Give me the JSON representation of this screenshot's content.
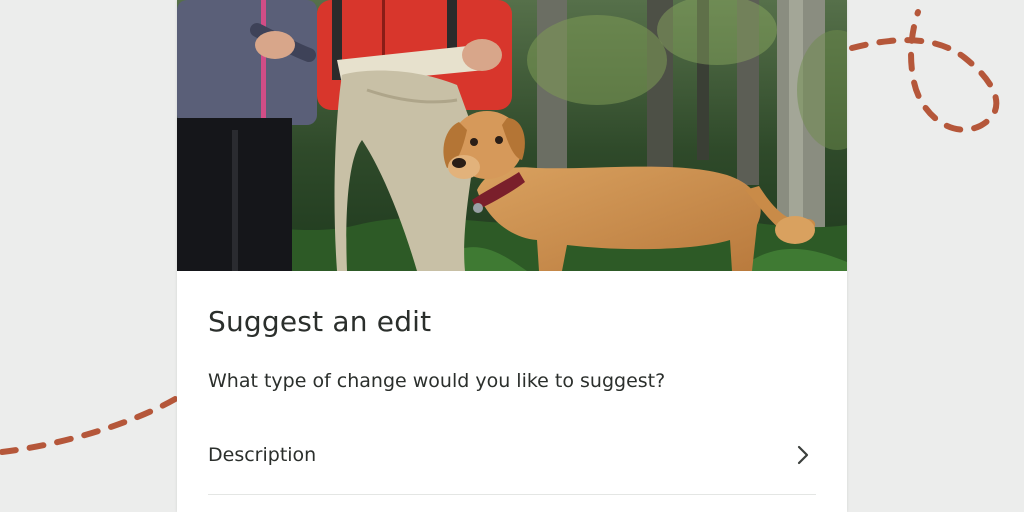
{
  "dialog": {
    "title": "Suggest an edit",
    "question": "What type of change would you like to suggest?",
    "options": [
      {
        "label": "Description",
        "icon": "chevron-right-icon"
      }
    ]
  },
  "photo": {
    "subject": "trail-photo"
  },
  "colors": {
    "background": "#ecedec",
    "card": "#ffffff",
    "text": "#2b2f2c",
    "accent_dashes": "#b5573a",
    "divider": "#e4e6e4"
  }
}
